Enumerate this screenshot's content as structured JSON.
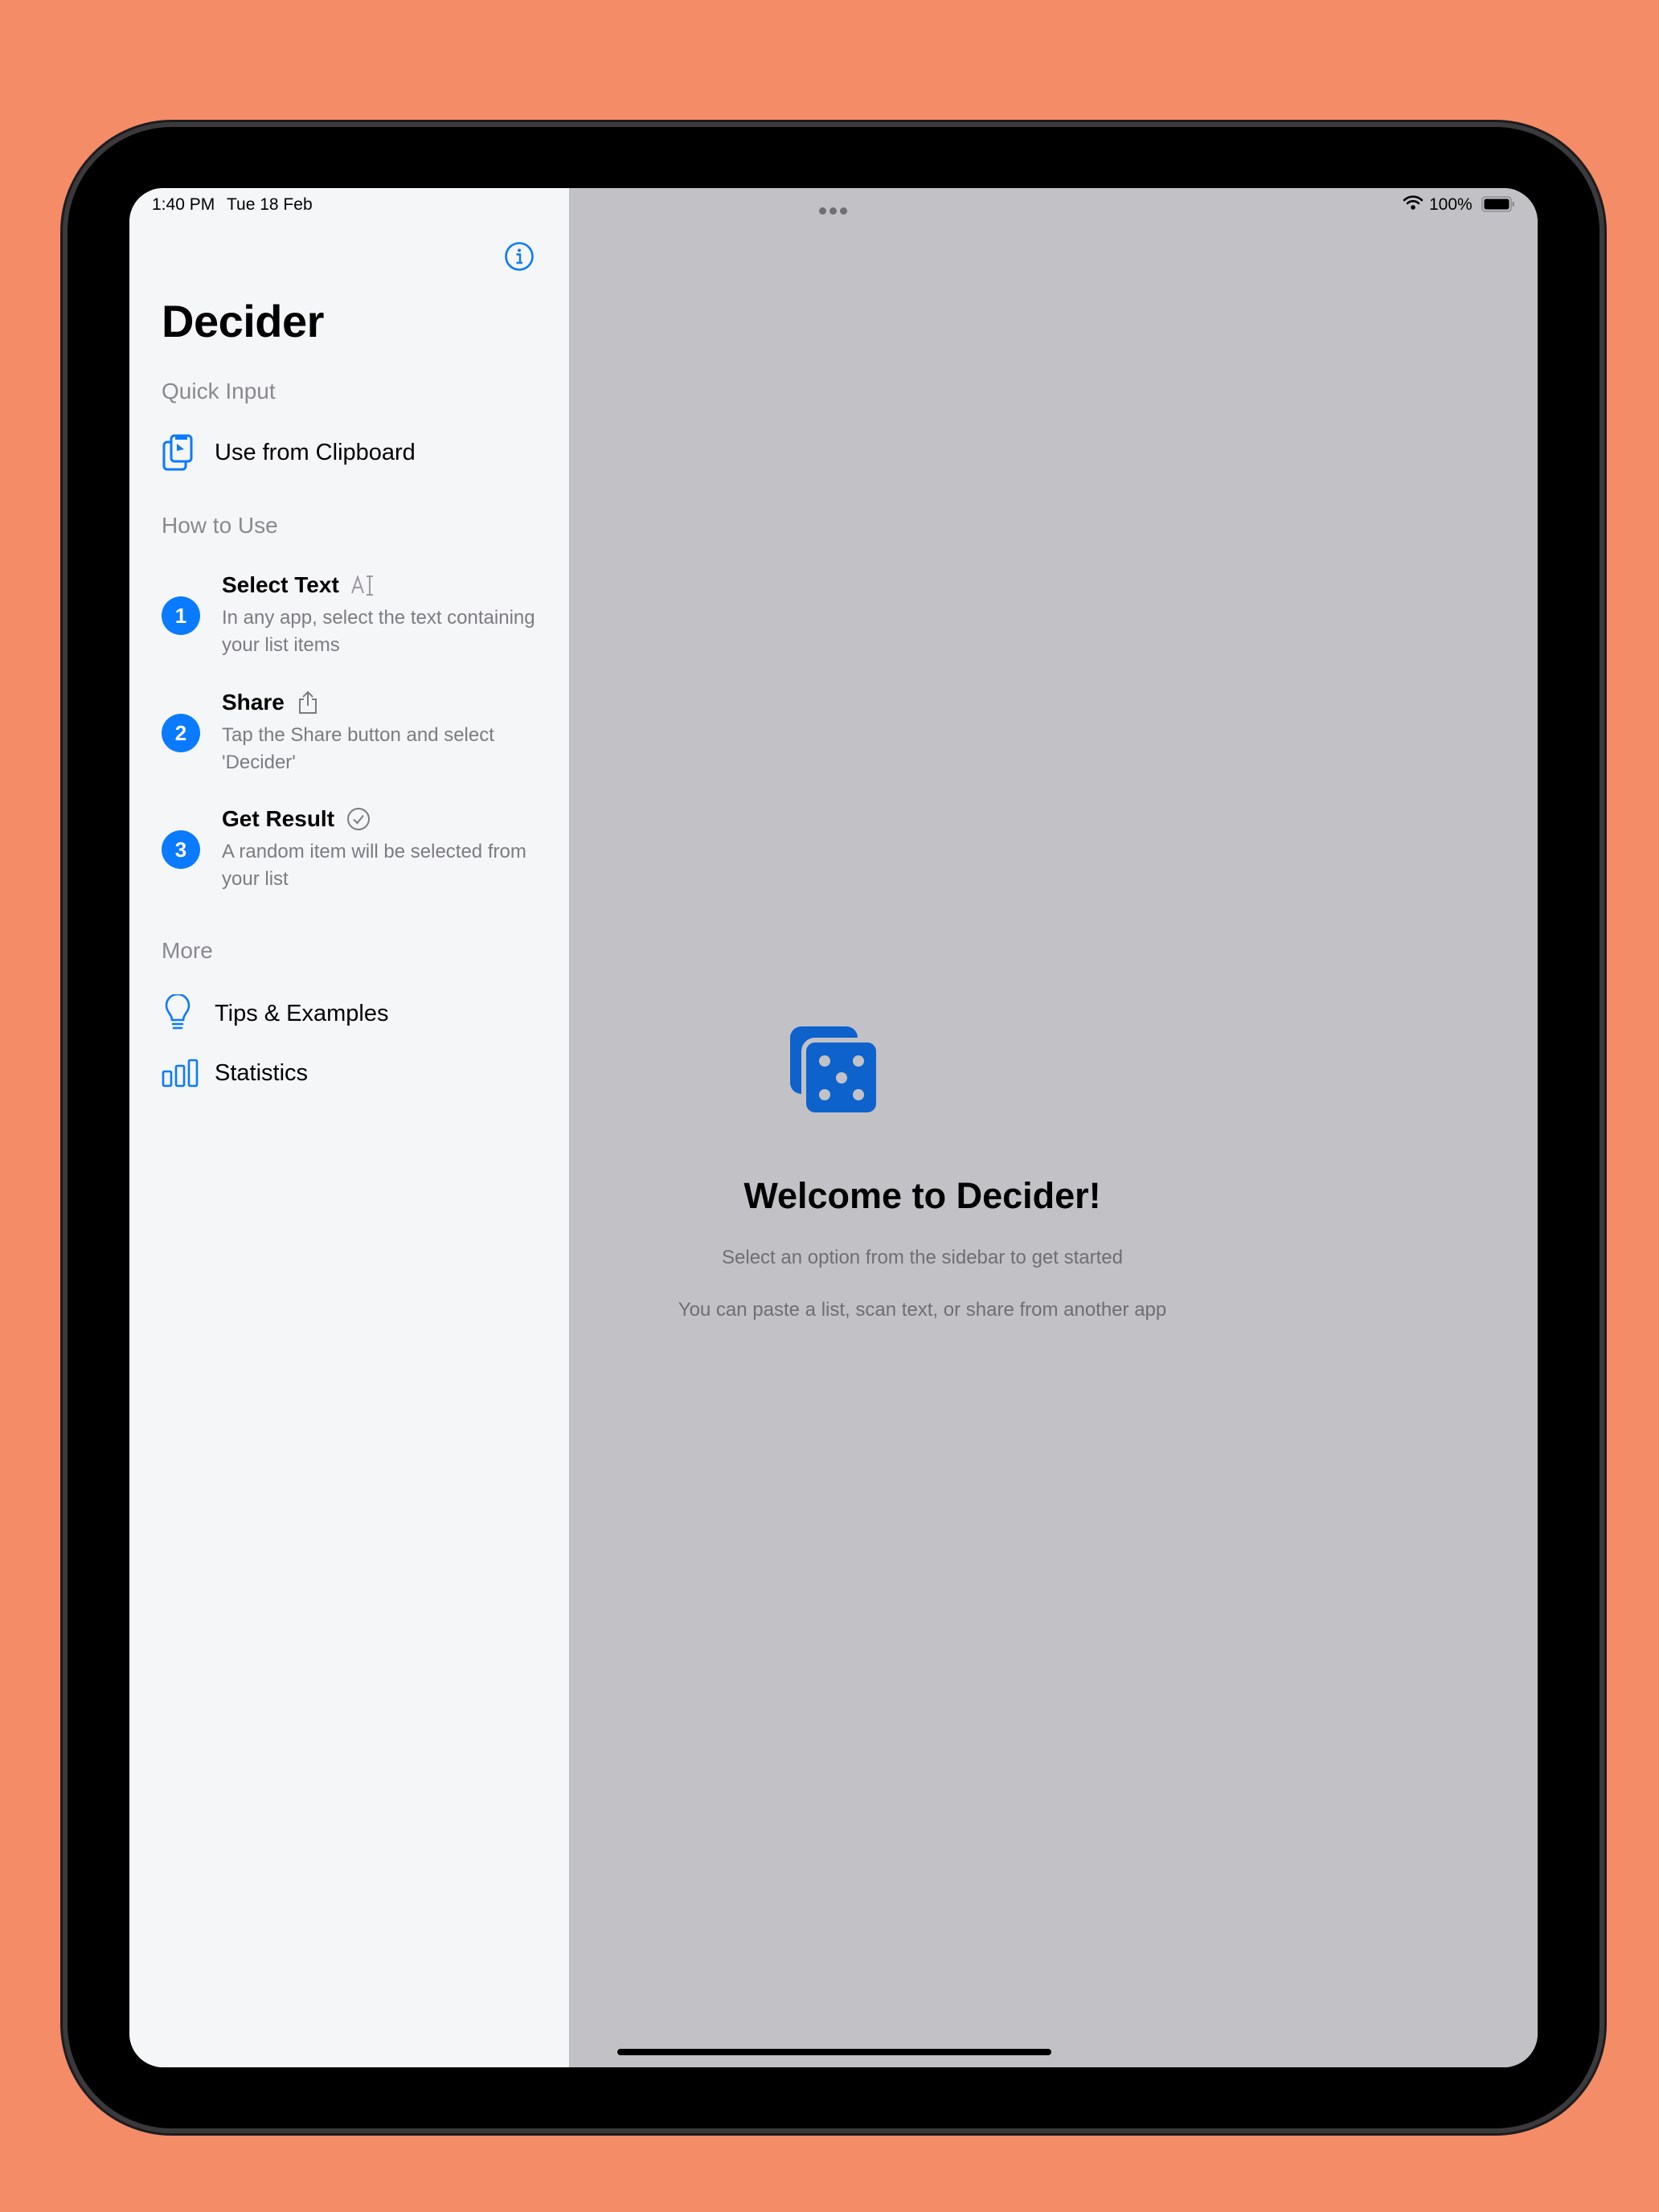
{
  "status_bar": {
    "time": "1:40 PM",
    "date": "Tue 18 Feb",
    "battery": "100%"
  },
  "sidebar": {
    "title": "Decider",
    "quick_input": {
      "header": "Quick Input",
      "items": [
        {
          "label": "Use from Clipboard",
          "icon": "clipboard-icon"
        }
      ]
    },
    "how_to_use": {
      "header": "How to Use",
      "steps": [
        {
          "number": "1",
          "title": "Select Text",
          "icon": "text-cursor-icon",
          "description": "In any app, select the text containing your list items"
        },
        {
          "number": "2",
          "title": "Share",
          "icon": "share-icon",
          "description": "Tap the Share button and select 'Decider'"
        },
        {
          "number": "3",
          "title": "Get Result",
          "icon": "checkmark-circle-icon",
          "description": "A random item will be selected from your list"
        }
      ]
    },
    "more": {
      "header": "More",
      "items": [
        {
          "label": "Tips & Examples",
          "icon": "lightbulb-icon"
        },
        {
          "label": "Statistics",
          "icon": "chart-bar-icon"
        }
      ]
    }
  },
  "detail": {
    "icon": "dice-icon",
    "title": "Welcome to Decider!",
    "subtitle": "Select an option from the sidebar to get started",
    "hint": "You can paste a list, scan text, or share from another app"
  },
  "colors": {
    "background": "#F48C68",
    "accent": "#0A7AFF",
    "sidebar_bg": "#F5F6F8",
    "detail_bg": "#C2C2C6"
  }
}
